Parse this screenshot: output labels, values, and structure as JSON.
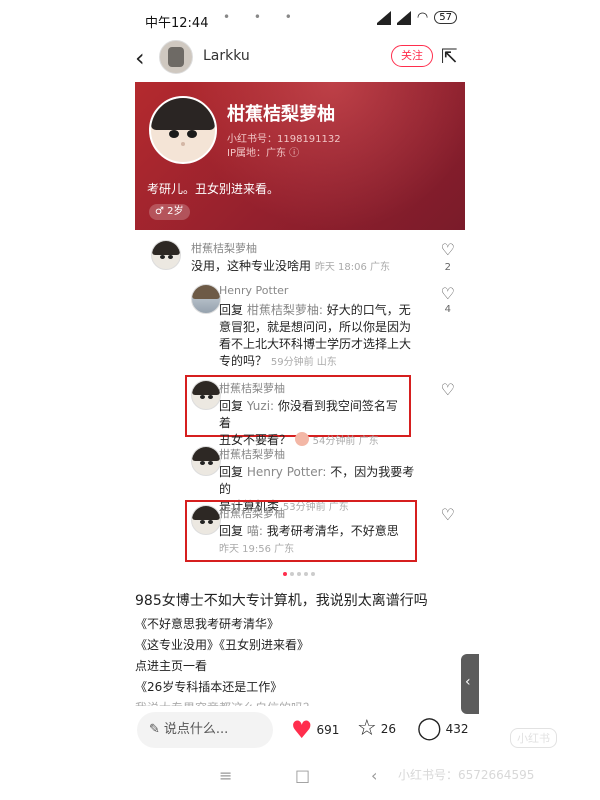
{
  "status": {
    "time": "中午12:44",
    "dots": "• • •",
    "battery": "57"
  },
  "header": {
    "username": "Larkku",
    "follow_label": "关注"
  },
  "profile": {
    "name": "柑蕉桔梨萝柚",
    "id": "小红书号：1198191132",
    "ip": "IP属地：广东 ⓘ",
    "bio": "考研儿。丑女别进来看。",
    "age_badge": "♂ 2岁"
  },
  "comments": [
    {
      "name": "柑蕉桔梨萝柚",
      "text": "没用，这种专业没啥用",
      "meta": "昨天 18:06 广东",
      "likes": "2"
    },
    {
      "name": "Henry Potter",
      "reply_prefix": "回复",
      "reply_to": "柑蕉桔梨萝柚:",
      "text_lines": [
        "好大的口气，无",
        "意冒犯，就是想问问，所以你是因为",
        "看不上北大环科博士学历才选择上大",
        "专的吗？"
      ],
      "meta": "59分钟前 山东",
      "likes": "4"
    },
    {
      "name": "柑蕉桔梨萝柚",
      "reply_prefix": "回复",
      "reply_to": "Yuzi:",
      "text_lines": [
        "你没看到我空间签名写着",
        "丑女不要看？"
      ],
      "meta": "54分钟前 广东"
    },
    {
      "name": "柑蕉桔梨萝柚",
      "reply_prefix": "回复",
      "reply_to": "Henry Potter:",
      "text_lines": [
        "不，因为我要考的",
        "是计算机类"
      ],
      "meta": "53分钟前 广东"
    },
    {
      "name": "柑蕉桔梨萝柚",
      "reply_prefix": "回复",
      "reply_to": "喵:",
      "text_lines": [
        "我考研考清华，不好意思"
      ],
      "meta": "昨天 19:56 广东"
    }
  ],
  "post": {
    "title": "985女博士不如大专计算机，我说别太离谱行吗",
    "lines": [
      "《不好意思我考研考清华》",
      "《这专业没用》《丑女别进来看》",
      "点进主页一看",
      "《26岁专科插本还是工作》",
      "我说大专男究竟都这么自信的吗？"
    ]
  },
  "bottom": {
    "input_placeholder": "说点什么...",
    "likes": "691",
    "stars": "26",
    "comments": "432"
  },
  "watermark": {
    "text": "小红书号：6572664595",
    "logo": "小红书"
  }
}
